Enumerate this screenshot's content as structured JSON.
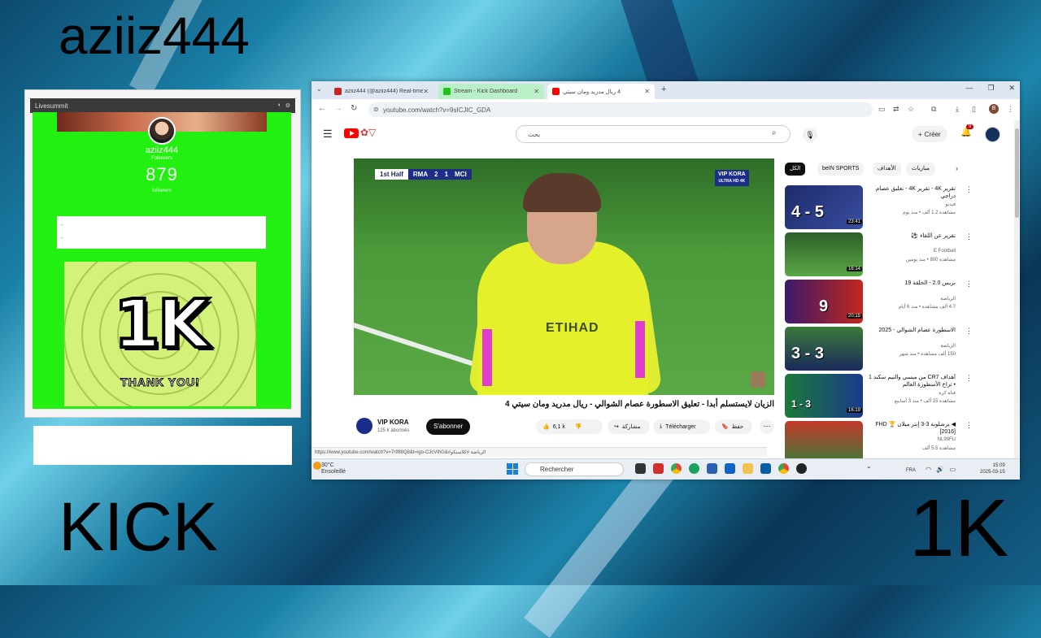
{
  "overlay": {
    "username": "aziiz444",
    "platform": "KICK",
    "milestone": "1K"
  },
  "widget": {
    "titlebar_label": "Livesummit",
    "profile_name": "aziiz444",
    "profile_sub": "Followers",
    "follower_count": "879",
    "count_label": "followers",
    "box_line_1": "..",
    "box_line_2": "..",
    "badge_text": "1K",
    "thank_you": "THANK YOU!"
  },
  "browser": {
    "tabs": [
      {
        "label": "aziiz444 (@aziiz444) Real-time Li...",
        "color": "#cc2222"
      },
      {
        "label": "Stream - Kick Dashboard",
        "color": "#22c11a"
      },
      {
        "label": "4 ريال مدريد ومان سيتي",
        "color": "#ff0000"
      }
    ],
    "new_tab": "+",
    "window_controls": [
      "—",
      "❐",
      "✕"
    ],
    "url": "youtube.com/watch?v=9sICJIC_GDA",
    "profile_initial": "B"
  },
  "youtube": {
    "search_placeholder": "بحث",
    "create_label": "Créer",
    "notif_count": "9",
    "video": {
      "half": "1st Half",
      "home": "RMA",
      "home_score": "2",
      "away_score": "1",
      "away": "MCI",
      "watermark_1": "VIP KORA",
      "watermark_2": "ULTRA HD 4K",
      "sponsor": "ETIHAD"
    },
    "title": "الزيان لايستسلم أبدا - تعليق الاسطورة عصام الشوالي - ريال مدريد ومان سيتي 4",
    "channel": {
      "name": "VIP KORA",
      "subscribers": "125 k abonnés",
      "subscribe_label": "S'abonner"
    },
    "actions": {
      "likes": "6,1 k",
      "share": "مشاركة",
      "download": "Télécharger",
      "save": "حفظ",
      "more": "⋯"
    },
    "status_url": "https://www.youtube.com/watch?v=7r9fl8Q8&t=igo-CJcVlhG&#الرياضة #كلاسيكو"
  },
  "chips": [
    "الكل",
    "beIN SPORTS",
    "الأهداف",
    "مباريات"
  ],
  "recommendations": [
    {
      "title": "تقرير 4K - تقرير 4K - تعليق عصام دراجي",
      "channel": "فيديو",
      "meta": "مشاهدة 1.2 ألف • منذ يوم",
      "duration": "23:41",
      "score": "4 - 5",
      "bg": "#2a3a7a"
    },
    {
      "title": "تقرير عن اللقاء ⚽",
      "channel": "E Football",
      "meta": "مشاهدة 800 • منذ يومين",
      "duration": "16:14",
      "score": "",
      "bg": "#3f7a38"
    },
    {
      "title": "بريس 2.0 - الحلقة 19",
      "channel": "الرياضة",
      "meta": "4.7 ألف مشاهدة • منذ 6 أيام",
      "duration": "20:15",
      "score": "9",
      "bg": "#5a1a1a"
    },
    {
      "title": "الاسطورة عصام الشوالي - 2025",
      "channel": "الرياضة",
      "meta": "150 ألف مشاهدة • منذ شهر",
      "duration": "",
      "score": "3 - 3",
      "bg": "#1b2a5a"
    },
    {
      "title": "أهداف CR7 من ميسي والتيم سكند 1 • تراخ الأسطورة العالم",
      "channel": "قناة كرة",
      "meta": "مشاهدة 15 ألف • منذ 3 أسابيع",
      "duration": "16:19",
      "score": "1 - 3",
      "bg": "#14305a"
    },
    {
      "title": "◀ برشلونة 3-3 إنتر ميلان 🏆 FHD [2016]",
      "channel": "NL99FU",
      "meta": "مشاهدة 5.5 ألف",
      "duration": "",
      "score": "",
      "bg": "#8a1a1a"
    }
  ],
  "taskbar": {
    "weather_temp": "30°C",
    "weather_desc": "Ensoleillé",
    "search_label": "Rechercher",
    "lang": "FRA",
    "time": "15:09",
    "date": "2025-03-15"
  }
}
